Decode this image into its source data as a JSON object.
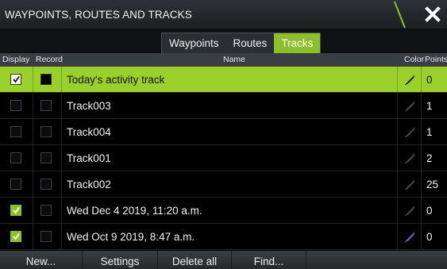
{
  "window": {
    "title": "WAYPOINTS, ROUTES AND TRACKS",
    "close_icon": "close-icon"
  },
  "tabs": [
    {
      "label": "Waypoints",
      "active": false
    },
    {
      "label": "Routes",
      "active": false
    },
    {
      "label": "Tracks",
      "active": true
    }
  ],
  "columns": {
    "display": "Display",
    "record": "Record",
    "name": "Name",
    "color": "Color",
    "points": "Points"
  },
  "tracks": [
    {
      "name": "Today's activity track",
      "display": true,
      "record": true,
      "points": "0",
      "color": "#1f2a10",
      "selected": true
    },
    {
      "name": "Track003",
      "display": false,
      "record": false,
      "points": "1",
      "color": "#3a3a3a",
      "selected": false
    },
    {
      "name": "Track004",
      "display": false,
      "record": false,
      "points": "1",
      "color": "#3a3a3a",
      "selected": false
    },
    {
      "name": "Track001",
      "display": false,
      "record": false,
      "points": "2",
      "color": "#3a3a3a",
      "selected": false
    },
    {
      "name": "Track002",
      "display": false,
      "record": false,
      "points": "25",
      "color": "#3a3a3a",
      "selected": false
    },
    {
      "name": "Wed Dec 4 2019, 11:20 a.m.",
      "display": true,
      "record": false,
      "points": "0",
      "color": "#3a3a3a",
      "selected": false
    },
    {
      "name": "Wed Oct 9 2019, 8:47 a.m.",
      "display": true,
      "record": false,
      "points": "0",
      "color": "#5b6fd6",
      "selected": false
    }
  ],
  "actions": {
    "new": "New...",
    "settings": "Settings",
    "delete_all": "Delete all",
    "find": "Find..."
  },
  "colors": {
    "accent": "#8cbf2a",
    "selected_row": "#9ad02b"
  }
}
